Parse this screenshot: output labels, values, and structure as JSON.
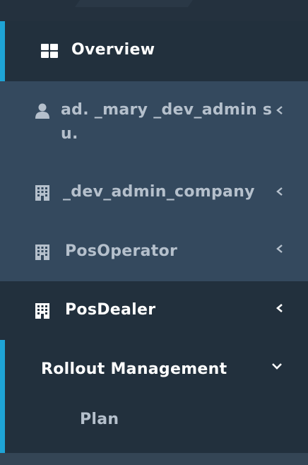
{
  "nav": {
    "overview": {
      "label": "Overview",
      "icon": "dashboard-grid-icon"
    },
    "user": {
      "label_line1": "ad. _mary _dev_admin s",
      "label_line2": "u.",
      "icon": "user-icon"
    },
    "company": {
      "label": "_dev_admin_company",
      "icon": "building-icon"
    },
    "pos_operator": {
      "label": "PosOperator",
      "icon": "building-icon"
    },
    "pos_dealer": {
      "label": "PosDealer",
      "icon": "building-icon"
    },
    "rollout": {
      "label": "Rollout Management",
      "icon": "chevron-down-icon"
    },
    "plan": {
      "label": "Plan"
    }
  },
  "colors": {
    "accent": "#1ea4d6",
    "active_bg": "#22303d",
    "item_bg": "#34495e",
    "muted_text": "#b5c0cc"
  }
}
